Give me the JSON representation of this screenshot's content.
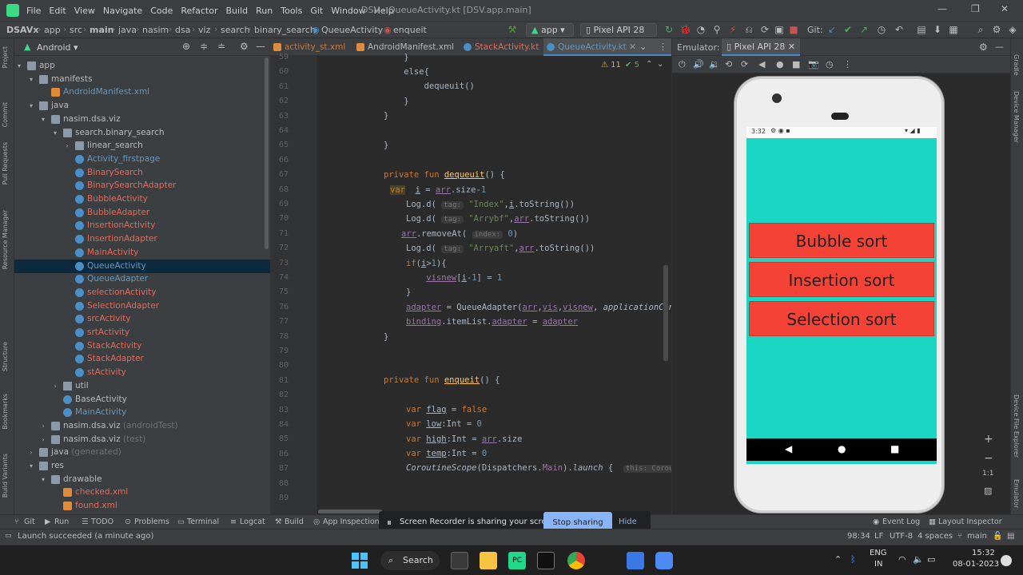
{
  "titlebar": {
    "menu": [
      "File",
      "Edit",
      "View",
      "Navigate",
      "Code",
      "Refactor",
      "Build",
      "Run",
      "Tools",
      "Git",
      "Window",
      "Help"
    ],
    "title": "DSV - QueueActivity.kt [DSV.app.main]"
  },
  "navbar": {
    "crumbs": [
      "DSAVx",
      "app",
      "src",
      "main",
      "java",
      "nasim",
      "dsa",
      "viz",
      "search",
      "binary_search",
      "QueueActivity",
      "enqueit"
    ],
    "run_config": "app",
    "device": "Pixel API 28",
    "git_label": "Git:"
  },
  "project": {
    "view": "Android",
    "tree": [
      {
        "label": "app",
        "indent": 0,
        "arrow": "▾",
        "icon": "folder",
        "color": "default"
      },
      {
        "label": "manifests",
        "indent": 1,
        "arrow": "▾",
        "icon": "folder",
        "color": "default"
      },
      {
        "label": "AndroidManifest.xml",
        "indent": 2,
        "arrow": "",
        "icon": "xml",
        "color": "blue"
      },
      {
        "label": "java",
        "indent": 1,
        "arrow": "▾",
        "icon": "folder",
        "color": "default"
      },
      {
        "label": "nasim.dsa.viz",
        "indent": 2,
        "arrow": "▾",
        "icon": "folder",
        "color": "default"
      },
      {
        "label": "search.binary_search",
        "indent": 3,
        "arrow": "▾",
        "icon": "folder",
        "color": "default"
      },
      {
        "label": "linear_search",
        "indent": 4,
        "arrow": "›",
        "icon": "folder",
        "color": "default"
      },
      {
        "label": "Activity_firstpage",
        "indent": 4,
        "arrow": "",
        "icon": "kt",
        "color": "blue"
      },
      {
        "label": "BinarySearch",
        "indent": 4,
        "arrow": "",
        "icon": "kt",
        "color": "red"
      },
      {
        "label": "BinarySearchAdapter",
        "indent": 4,
        "arrow": "",
        "icon": "kt",
        "color": "red"
      },
      {
        "label": "BubbleActivity",
        "indent": 4,
        "arrow": "",
        "icon": "kt",
        "color": "red"
      },
      {
        "label": "BubbleAdapter",
        "indent": 4,
        "arrow": "",
        "icon": "kt",
        "color": "red"
      },
      {
        "label": "InsertionActivity",
        "indent": 4,
        "arrow": "",
        "icon": "kt",
        "color": "red"
      },
      {
        "label": "InsertionAdapter",
        "indent": 4,
        "arrow": "",
        "icon": "kt",
        "color": "red"
      },
      {
        "label": "MainActivity",
        "indent": 4,
        "arrow": "",
        "icon": "kt",
        "color": "red"
      },
      {
        "label": "QueueActivity",
        "indent": 4,
        "arrow": "",
        "icon": "kt",
        "color": "blue",
        "selected": true
      },
      {
        "label": "QueueAdapter",
        "indent": 4,
        "arrow": "",
        "icon": "kt",
        "color": "blue"
      },
      {
        "label": "selectionActivity",
        "indent": 4,
        "arrow": "",
        "icon": "kt",
        "color": "red"
      },
      {
        "label": "SelectionAdapter",
        "indent": 4,
        "arrow": "",
        "icon": "kt",
        "color": "red"
      },
      {
        "label": "srcActivity",
        "indent": 4,
        "arrow": "",
        "icon": "kt",
        "color": "red"
      },
      {
        "label": "srtActivity",
        "indent": 4,
        "arrow": "",
        "icon": "kt",
        "color": "red"
      },
      {
        "label": "StackActivity",
        "indent": 4,
        "arrow": "",
        "icon": "kt",
        "color": "red"
      },
      {
        "label": "StackAdapter",
        "indent": 4,
        "arrow": "",
        "icon": "kt",
        "color": "red"
      },
      {
        "label": "stActivity",
        "indent": 4,
        "arrow": "",
        "icon": "kt",
        "color": "red"
      },
      {
        "label": "util",
        "indent": 3,
        "arrow": "›",
        "icon": "folder",
        "color": "default"
      },
      {
        "label": "BaseActivity",
        "indent": 3,
        "arrow": "",
        "icon": "kt",
        "color": "default"
      },
      {
        "label": "MainActivity",
        "indent": 3,
        "arrow": "",
        "icon": "kt",
        "color": "blue"
      },
      {
        "label": "nasim.dsa.viz (androidTest)",
        "indent": 2,
        "arrow": "›",
        "icon": "folder",
        "color": "default"
      },
      {
        "label": "nasim.dsa.viz (test)",
        "indent": 2,
        "arrow": "›",
        "icon": "folder",
        "color": "default"
      },
      {
        "label": "java (generated)",
        "indent": 1,
        "arrow": "›",
        "icon": "folder",
        "color": "default"
      },
      {
        "label": "res",
        "indent": 1,
        "arrow": "▾",
        "icon": "folder",
        "color": "default"
      },
      {
        "label": "drawable",
        "indent": 2,
        "arrow": "▾",
        "icon": "folder",
        "color": "default"
      },
      {
        "label": "checked.xml",
        "indent": 3,
        "arrow": "",
        "icon": "xml",
        "color": "red"
      },
      {
        "label": "found.xml",
        "indent": 3,
        "arrow": "",
        "icon": "xml",
        "color": "red"
      }
    ]
  },
  "editor": {
    "tabs": [
      {
        "label": "activity_st.xml",
        "color": "orange"
      },
      {
        "label": "AndroidManifest.xml",
        "color": "default"
      },
      {
        "label": "StackActivity.kt",
        "color": "red"
      },
      {
        "label": "QueueActivity.kt",
        "color": "blue",
        "active": true
      }
    ],
    "warnings": "⚠ 11",
    "checks": "✔ 5",
    "line_numbers": [
      "59",
      "60",
      "61",
      "62",
      "63",
      "64",
      "65",
      "66",
      "67",
      "68",
      "69",
      "70",
      "71",
      "72",
      "73",
      "74",
      "75",
      "76",
      "77",
      "78",
      "79",
      "80",
      "81",
      "82",
      "83",
      "84",
      "85",
      "86",
      "87",
      "88",
      "89"
    ]
  },
  "emulator": {
    "label": "Emulator:",
    "device_tab": "Pixel API 28",
    "phone": {
      "time": "3:32",
      "buttons": [
        "Bubble sort",
        "Insertion sort",
        "Selection sort"
      ]
    }
  },
  "bottom_tools": [
    "Git",
    "Run",
    "TODO",
    "Problems",
    "Terminal",
    "Logcat",
    "Build",
    "App Inspection",
    "Event Log",
    "Layout Inspector"
  ],
  "share": {
    "message": "Screen Recorder is sharing your screen.",
    "stop": "Stop sharing",
    "hide": "Hide"
  },
  "status": {
    "message": "Launch succeeded (a minute ago)",
    "position": "98:34",
    "lf": "LF",
    "encoding": "UTF-8",
    "indent": "4 spaces",
    "branch": "main"
  },
  "taskbar": {
    "search": "Search",
    "lang1": "ENG",
    "lang2": "IN",
    "time": "15:32",
    "date": "08-01-2023"
  },
  "right_strip": [
    "Gradle",
    "Device Manager",
    "Device File Explorer",
    "Emulator"
  ],
  "left_strip": [
    "Project",
    "Commit",
    "Pull Requests",
    "Resource Manager",
    "Structure",
    "Bookmarks",
    "Build Variants"
  ],
  "colors": {
    "accent": "#4a88c7",
    "phone_bg": "#1ad6c2",
    "button": "#f44336"
  }
}
